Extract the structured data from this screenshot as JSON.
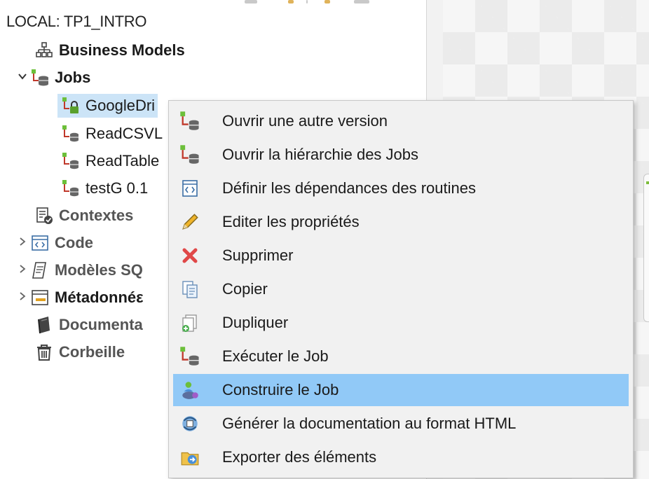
{
  "panel": {
    "title": "LOCAL: TP1_INTRO",
    "tree": [
      {
        "label": "Business Models",
        "icon": "business-models-icon"
      },
      {
        "label": "Jobs",
        "icon": "jobs-folder-icon",
        "expanded": true
      },
      {
        "label": "GoogleDri",
        "icon": "locked-job-icon",
        "selected": true
      },
      {
        "label": "ReadCSVL",
        "icon": "job-icon"
      },
      {
        "label": "ReadTable",
        "icon": "job-icon"
      },
      {
        "label": "testG 0.1",
        "icon": "job-icon"
      },
      {
        "label": "Contextes",
        "icon": "contexts-icon"
      },
      {
        "label": "Code",
        "icon": "code-icon",
        "collapsed": true
      },
      {
        "label": "Modèles SQ",
        "icon": "sql-templates-icon",
        "collapsed": true
      },
      {
        "label": "Métadonnéε",
        "icon": "metadata-icon",
        "collapsed": true
      },
      {
        "label": "Documenta",
        "icon": "documentation-icon"
      },
      {
        "label": "Corbeille",
        "icon": "trash-icon"
      }
    ]
  },
  "context_menu": {
    "items": [
      {
        "label": "Ouvrir une autre version",
        "icon": "job-icon"
      },
      {
        "label": "Ouvrir la hiérarchie des Jobs",
        "icon": "job-icon"
      },
      {
        "label": "Définir les dépendances des routines",
        "icon": "routine-icon"
      },
      {
        "label": "Editer les propriétés",
        "icon": "pencil-icon"
      },
      {
        "label": "Supprimer",
        "icon": "delete-icon"
      },
      {
        "label": "Copier",
        "icon": "copy-icon"
      },
      {
        "label": "Dupliquer",
        "icon": "duplicate-icon"
      },
      {
        "label": "Exécuter le Job",
        "icon": "run-job-icon"
      },
      {
        "label": "Construire le Job",
        "icon": "build-job-icon",
        "highlighted": true
      },
      {
        "label": "Générer la documentation au format HTML",
        "icon": "generate-doc-icon"
      },
      {
        "label": "Exporter des éléments",
        "icon": "export-icon"
      }
    ]
  },
  "colors": {
    "menu_highlight": "#91c9f7",
    "selection": "#cce4f7",
    "job_green": "#5cb85c"
  }
}
